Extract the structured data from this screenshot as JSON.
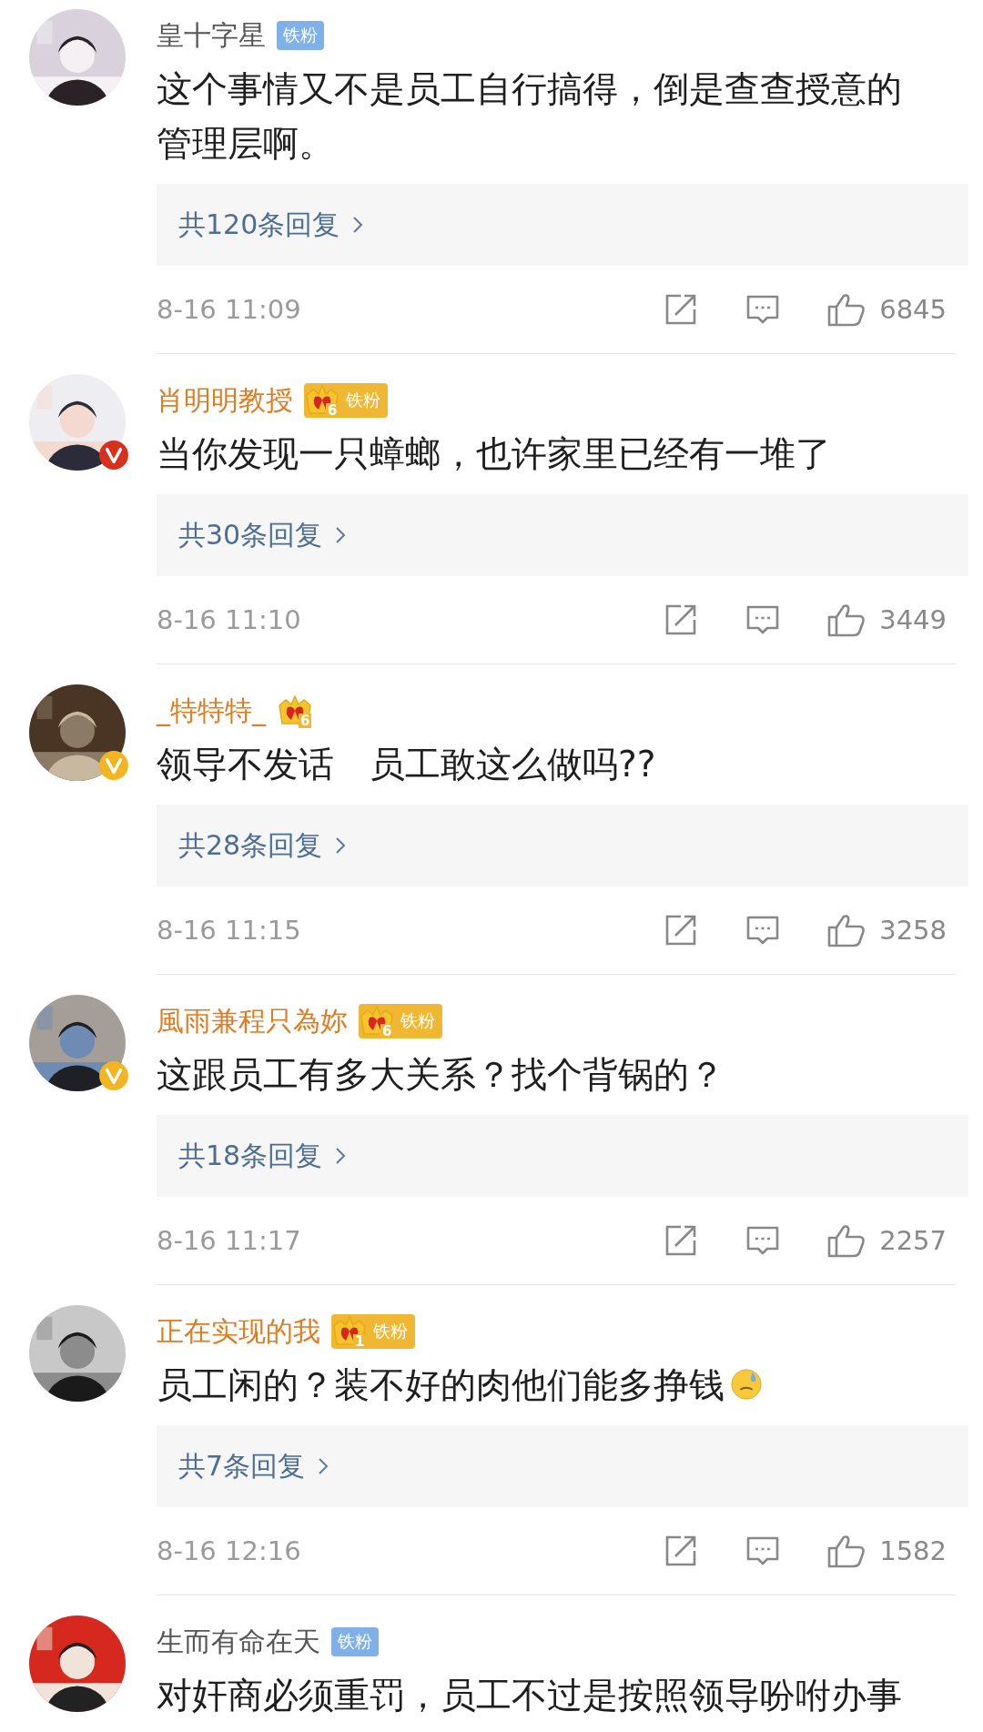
{
  "comments": [
    {
      "author": "皇十字星",
      "vip": false,
      "verified": false,
      "badge": {
        "kind": "fan",
        "label": "铁粉"
      },
      "text": "这个事情又不是员工自行搞得，倒是查查授意的管理层啊。",
      "replies": "共120条回复",
      "time": "8-16 11:09",
      "likes": "6845"
    },
    {
      "author": "肖明明教授",
      "vip": true,
      "verified": true,
      "color": "#d8301c",
      "badge": {
        "kind": "crown",
        "level": "6",
        "label": "铁粉"
      },
      "text": "当你发现一只蟑螂，也许家里已经有一堆了",
      "replies": "共30条回复",
      "time": "8-16 11:10",
      "likes": "3449"
    },
    {
      "author": "_特特特_",
      "vip": true,
      "verified": true,
      "color": "#f3b521",
      "badge": {
        "kind": "crown",
        "level": "6"
      },
      "text": "领导不发话　员工敢这么做吗??",
      "replies": "共28条回复",
      "time": "8-16 11:15",
      "likes": "3258"
    },
    {
      "author": "風雨兼程只為妳",
      "vip": true,
      "verified": true,
      "color": "#f3b521",
      "badge": {
        "kind": "crown",
        "level": "6",
        "label": "铁粉"
      },
      "text": "这跟员工有多大关系？找个背锅的？",
      "replies": "共18条回复",
      "time": "8-16 11:17",
      "likes": "2257"
    },
    {
      "author": "正在实现的我",
      "vip": true,
      "verified": false,
      "badge": {
        "kind": "crown",
        "level": "1",
        "label": "铁粉"
      },
      "text": "员工闲的？装不好的肉他们能多挣钱",
      "ends_with_emoji": true,
      "replies": "共7条回复",
      "time": "8-16 12:16",
      "likes": "1582"
    },
    {
      "author": "生而有命在天",
      "vip": false,
      "verified": false,
      "badge": {
        "kind": "fan",
        "label": "铁粉"
      },
      "text": "对奸商必须重罚，员工不过是按照领导吩咐办事"
    }
  ]
}
